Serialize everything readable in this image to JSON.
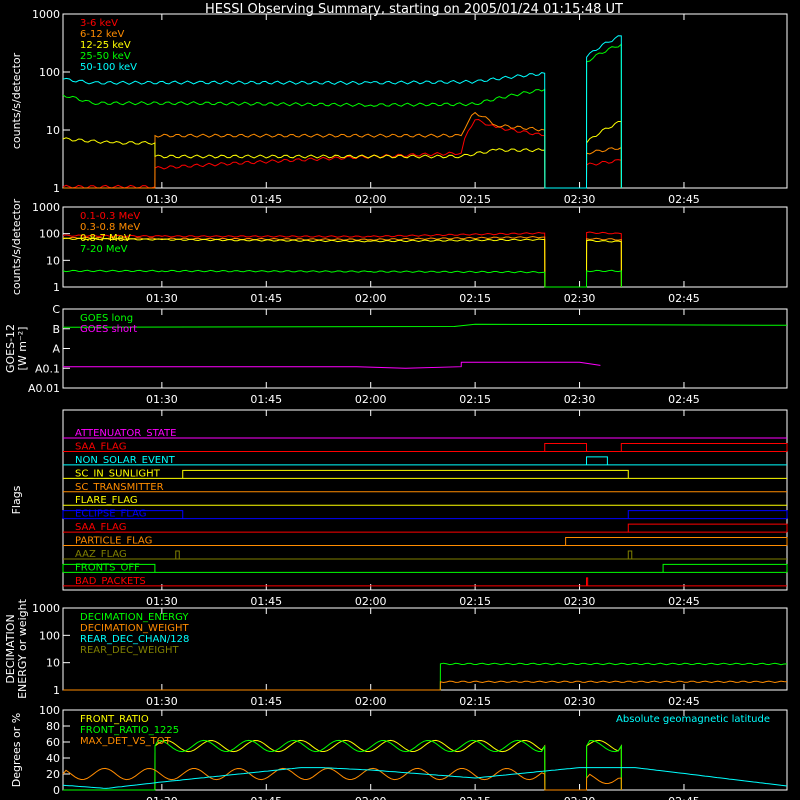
{
  "chart_data": {
    "type": "line",
    "title": "HESSI Observing Summary, starting on 2005/01/24 01:15:48 UT",
    "x_ticks": [
      "01:30",
      "01:45",
      "02:00",
      "02:15",
      "02:30",
      "02:45"
    ],
    "x_range": [
      "01:15:48",
      "02:59:48"
    ],
    "panels": [
      {
        "id": "lowE",
        "ylabel": "counts/s/detector",
        "scale": "log",
        "ylim": [
          1,
          1000
        ],
        "y_ticks": [
          "1",
          "10",
          "100",
          "1000"
        ],
        "series": [
          {
            "name": "3-6 keV",
            "color": "#ff0000",
            "x": [
              "01:15:48",
              "01:29:00",
              "01:29:01",
              "02:13:00",
              "02:15:00",
              "02:18:00",
              "02:25:00",
              "02:25:01",
              "02:31:00",
              "02:31:01",
              "02:36:00",
              "02:36:01"
            ],
            "y": [
              1.05,
              1.05,
              2.2,
              4,
              15,
              11,
              8,
              1,
              1,
              2.5,
              3,
              1
            ]
          },
          {
            "name": "6-12 keV",
            "color": "#ff8c00",
            "x": [
              "01:15:48",
              "01:29:00",
              "01:29:01",
              "02:13:00",
              "02:15:00",
              "02:18:00",
              "02:25:00",
              "02:25:01",
              "02:31:00",
              "02:31:01",
              "02:36:00",
              "02:36:01"
            ],
            "y": [
              1,
              1,
              8,
              8,
              20,
              12,
              10,
              1,
              1,
              4,
              5,
              1
            ]
          },
          {
            "name": "12-25 keV",
            "color": "#ffff00",
            "x": [
              "01:15:48",
              "01:23:00",
              "01:29:00",
              "01:29:01",
              "02:13:00",
              "02:18:00",
              "02:25:00",
              "02:25:01",
              "02:31:00",
              "02:31:01",
              "02:36:00",
              "02:36:01"
            ],
            "y": [
              7,
              6,
              6,
              3.5,
              3.5,
              4.5,
              4.5,
              1,
              1,
              6,
              14,
              1
            ]
          },
          {
            "name": "25-50 keV",
            "color": "#00ff00",
            "x": [
              "01:15:48",
              "01:20:00",
              "01:35:00",
              "02:00:00",
              "02:15:00",
              "02:25:00",
              "02:25:01",
              "02:31:00",
              "02:31:01",
              "02:36:00",
              "02:36:01"
            ],
            "y": [
              40,
              29,
              29,
              27,
              28,
              50,
              1,
              1,
              150,
              300,
              1
            ]
          },
          {
            "name": "50-100 keV",
            "color": "#00ffff",
            "x": [
              "01:15:48",
              "01:20:00",
              "01:35:00",
              "02:00:00",
              "02:15:00",
              "02:25:00",
              "02:25:01",
              "02:31:00",
              "02:31:01",
              "02:36:00",
              "02:36:01"
            ],
            "y": [
              75,
              65,
              66,
              65,
              68,
              95,
              1,
              1,
              180,
              420,
              1
            ]
          }
        ]
      },
      {
        "id": "highE",
        "ylabel": "counts/s/detector",
        "scale": "log",
        "ylim": [
          1,
          1000
        ],
        "y_ticks": [
          "1",
          "10",
          "100",
          "1000"
        ],
        "series": [
          {
            "name": "0.1-0.3 MeV",
            "color": "#ff0000",
            "x": [
              "01:15:48",
              "01:30:00",
              "02:00:00",
              "02:25:00",
              "02:25:01",
              "02:31:00",
              "02:31:01",
              "02:36:00",
              "02:36:01"
            ],
            "y": [
              85,
              80,
              78,
              105,
              1,
              1,
              110,
              100,
              1
            ]
          },
          {
            "name": "0.3-0.8 MeV",
            "color": "#ff8c00",
            "x": [
              "01:15:48",
              "01:30:00",
              "02:00:00",
              "02:25:00",
              "02:25:01",
              "02:31:00",
              "02:31:01",
              "02:36:00",
              "02:36:01"
            ],
            "y": [
              70,
              65,
              60,
              75,
              1,
              1,
              65,
              60,
              1
            ]
          },
          {
            "name": "0.8-7 MeV",
            "color": "#ffff00",
            "x": [
              "01:15:48",
              "01:30:00",
              "02:00:00",
              "02:25:00",
              "02:25:01",
              "02:31:00",
              "02:31:01",
              "02:36:00",
              "02:36:01"
            ],
            "y": [
              65,
              60,
              52,
              60,
              1,
              1,
              55,
              50,
              1
            ]
          },
          {
            "name": "7-20 MeV",
            "color": "#00ff00",
            "x": [
              "01:15:48",
              "01:30:00",
              "02:00:00",
              "02:25:00",
              "02:25:01",
              "02:31:00",
              "02:31:01",
              "02:36:00",
              "02:36:01"
            ],
            "y": [
              4,
              4,
              3.8,
              3.6,
              1,
              1,
              4,
              4,
              1
            ]
          }
        ]
      },
      {
        "id": "goes",
        "ylabel": "GOES-12",
        "ylabel2": "[W m⁻²]",
        "scale": "log",
        "ylim": [
          "A0.01",
          "C"
        ],
        "y_ticks": [
          "A0.01",
          "A0.1",
          "A",
          "B",
          "C"
        ],
        "series": [
          {
            "name": "GOES long",
            "color": "#00ff00",
            "x": [
              "01:15:48",
              "02:12:00",
              "02:15:00",
              "02:59:48"
            ],
            "y": [
              "1.2B",
              "1.3B",
              "1.7B",
              "1.5B"
            ]
          },
          {
            "name": "GOES short",
            "color": "#ff00ff",
            "x": [
              "01:15:48",
              "01:58:00",
              "02:05:00",
              "02:13:00",
              "02:13:01",
              "02:30:00",
              "02:33:00"
            ],
            "y": [
              "0.12A",
              "0.12A",
              "0.1A",
              "0.12A",
              "0.2A",
              "0.2A",
              "0.14A"
            ]
          }
        ]
      },
      {
        "id": "flags",
        "ylabel": "Flags",
        "flags": [
          {
            "name": "ATTENUATOR_STATE",
            "color": "#ff00ff",
            "segments": []
          },
          {
            "name": "SAA_FLAG",
            "color": "#ff0000",
            "segments": [
              [
                "02:25:00",
                "02:31:00"
              ],
              [
                "02:36:00",
                "02:59:48"
              ]
            ]
          },
          {
            "name": "NON_SOLAR_EVENT",
            "color": "#00ffff",
            "segments": [
              [
                "02:31:00",
                "02:34:00"
              ]
            ]
          },
          {
            "name": "SC_IN_SUNLIGHT",
            "color": "#ffff00",
            "segments": [
              [
                "01:33:00",
                "02:37:00"
              ]
            ]
          },
          {
            "name": "SC_TRANSMITTER",
            "color": "#ff8c00",
            "segments": []
          },
          {
            "name": "FLARE_FLAG",
            "color": "#ffff00",
            "segments": []
          },
          {
            "name": "ECLIPSE_FLAG",
            "color": "#0000ff",
            "segments": [
              [
                "01:15:48",
                "01:33:00"
              ],
              [
                "02:37:00",
                "02:59:48"
              ]
            ]
          },
          {
            "name": "SAA_FLAG",
            "color": "#ff0000",
            "segments": [
              [
                "02:37:00",
                "02:59:48"
              ]
            ]
          },
          {
            "name": "PARTICLE_FLAG",
            "color": "#ff8c00",
            "segments": [
              [
                "02:28:00",
                "02:59:48"
              ]
            ]
          },
          {
            "name": "AAZ_FLAG",
            "color": "#808000",
            "segments": [
              [
                "01:32:00",
                "01:32:30"
              ],
              [
                "02:37:00",
                "02:37:30"
              ]
            ]
          },
          {
            "name": "FRONTS_OFF",
            "color": "#00ff00",
            "segments": [
              [
                "01:15:48",
                "01:29:00"
              ],
              [
                "02:42:00",
                "02:59:48"
              ]
            ]
          },
          {
            "name": "BAD_PACKETS",
            "color": "#ff0000",
            "segments": [
              [
                "02:31:00",
                "02:31:10"
              ]
            ]
          }
        ]
      },
      {
        "id": "decimation",
        "ylabel": "DECIMATION",
        "ylabel2": "ENERGY or weight",
        "scale": "log",
        "ylim": [
          1,
          1000
        ],
        "y_ticks": [
          "1",
          "10",
          "100",
          "1000"
        ],
        "series": [
          {
            "name": "DECIMATION_ENERGY",
            "color": "#00ff00",
            "x": [
              "01:15:48",
              "02:10:00",
              "02:10:01",
              "02:59:48"
            ],
            "y": [
              1,
              1,
              9,
              9
            ]
          },
          {
            "name": "DECIMATION_WEIGHT",
            "color": "#ff8c00",
            "x": [
              "01:15:48",
              "02:10:00",
              "02:10:01",
              "02:59:48"
            ],
            "y": [
              1,
              1,
              2,
              2
            ]
          },
          {
            "name": "REAR_DEC_CHAN/128",
            "color": "#00ffff",
            "x": [],
            "y": []
          },
          {
            "name": "REAR_DEC_WEIGHT",
            "color": "#808000",
            "x": [],
            "y": []
          }
        ]
      },
      {
        "id": "ratio",
        "ylabel": "Degrees or %",
        "scale": "linear",
        "ylim": [
          0,
          100
        ],
        "y_ticks": [
          "0",
          "20",
          "40",
          "60",
          "80",
          "100"
        ],
        "annotation": "Absolute geomagnetic latitude",
        "annotation_color": "#00ffff",
        "series": [
          {
            "name": "FRONT_RATIO",
            "color": "#ffff00",
            "x": [
              "01:15:48",
              "01:29:00",
              "01:29:01",
              "02:25:00",
              "02:25:01",
              "02:31:00",
              "02:31:01",
              "02:36:00",
              "02:36:01"
            ],
            "y": [
              0,
              0,
              55,
              55,
              0,
              0,
              55,
              55,
              0
            ]
          },
          {
            "name": "FRONT_RATIO_1225",
            "color": "#00ff00",
            "x": [
              "01:15:48",
              "01:29:00",
              "01:29:01",
              "02:25:00",
              "02:25:01",
              "02:31:00",
              "02:31:01",
              "02:36:00",
              "02:36:01"
            ],
            "y": [
              0,
              0,
              55,
              55,
              0,
              0,
              55,
              55,
              0
            ]
          },
          {
            "name": "MAX_DET_VS_TOT",
            "color": "#ff8c00",
            "x": [
              "01:15:48",
              "02:25:00",
              "02:25:01",
              "02:31:00",
              "02:31:01",
              "02:36:00",
              "02:36:01"
            ],
            "y": [
              20,
              20,
              0,
              0,
              15,
              15,
              0
            ]
          },
          {
            "name": "Absolute geomagnetic latitude",
            "color": "#00ffff",
            "x": [
              "01:15:48",
              "01:22:00",
              "01:30:00",
              "01:50:00",
              "01:53:00",
              "02:00:00",
              "02:15:00",
              "02:30:00",
              "02:38:00",
              "02:59:48"
            ],
            "y": [
              6,
              2,
              10,
              28,
              28,
              25,
              15,
              28,
              28,
              5
            ]
          }
        ]
      }
    ]
  }
}
